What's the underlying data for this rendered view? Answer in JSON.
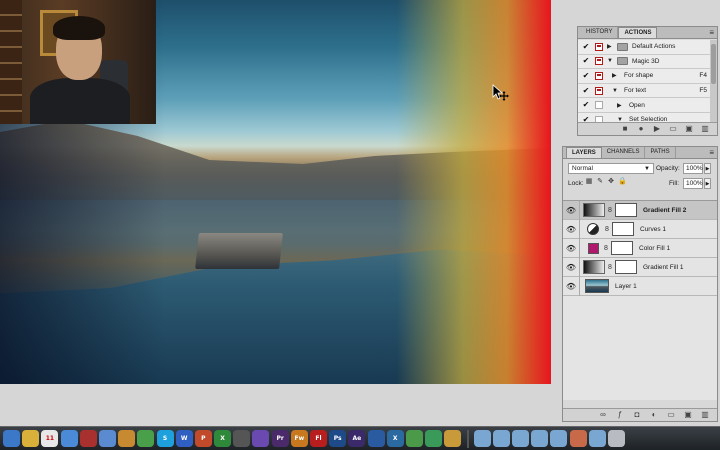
{
  "history_actions_panel": {
    "tabs": [
      "HISTORY",
      "ACTIONS"
    ],
    "active_tab": "ACTIONS",
    "rows": [
      {
        "checked": true,
        "dialog": true,
        "expand": "collapsed",
        "folder": true,
        "label": "Default Actions",
        "key": ""
      },
      {
        "checked": true,
        "dialog": true,
        "expand": "expanded",
        "folder": true,
        "label": "Magic 3D",
        "key": ""
      },
      {
        "checked": true,
        "dialog": true,
        "expand": "collapsed",
        "folder": false,
        "label": "For shape",
        "key": "F4"
      },
      {
        "checked": true,
        "dialog": true,
        "expand": "expanded",
        "folder": false,
        "label": "For text",
        "key": "F5"
      },
      {
        "checked": true,
        "dialog": false,
        "expand": "collapsed",
        "folder": false,
        "label": "Open",
        "key": ""
      },
      {
        "checked": true,
        "dialog": false,
        "expand": "expanded",
        "folder": false,
        "label": "Set Selection",
        "key": ""
      }
    ]
  },
  "layers_panel": {
    "tabs": [
      "LAYERS",
      "CHANNELS",
      "PATHS"
    ],
    "active_tab": "LAYERS",
    "blend_mode": "Normal",
    "opacity_label": "Opacity:",
    "opacity_value": "100%",
    "lock_label": "Lock:",
    "fill_label": "Fill:",
    "fill_value": "100%",
    "layers": [
      {
        "name": "Gradient Fill 2",
        "type": "gradient",
        "selected": true
      },
      {
        "name": "Curves 1",
        "type": "curves",
        "selected": false
      },
      {
        "name": "Color Fill 1",
        "type": "color",
        "selected": false
      },
      {
        "name": "Gradient Fill 1",
        "type": "gradient",
        "selected": false
      },
      {
        "name": "Layer 1",
        "type": "photo",
        "selected": false
      }
    ]
  },
  "dock": {
    "icons": [
      {
        "name": "finder",
        "label": "",
        "color": "#3c78c8"
      },
      {
        "name": "notes",
        "label": "",
        "color": "#d9b13a"
      },
      {
        "name": "calendar",
        "label": "11",
        "color": "#e8e8e8"
      },
      {
        "name": "itunes",
        "label": "",
        "color": "#4a8ad6"
      },
      {
        "name": "photo-booth",
        "label": "",
        "color": "#a8302e"
      },
      {
        "name": "iphoto",
        "label": "",
        "color": "#5a8ad0"
      },
      {
        "name": "paintbrush",
        "label": "",
        "color": "#c88a30"
      },
      {
        "name": "chrome",
        "label": "",
        "color": "#4aa04a"
      },
      {
        "name": "skype",
        "label": "S",
        "color": "#1ea0dc"
      },
      {
        "name": "word",
        "label": "W",
        "color": "#2f5fc0"
      },
      {
        "name": "powerpoint",
        "label": "P",
        "color": "#c04a2a"
      },
      {
        "name": "excel",
        "label": "X",
        "color": "#2e8a3a"
      },
      {
        "name": "clapper",
        "label": "",
        "color": "#555555"
      },
      {
        "name": "imovie",
        "label": "",
        "color": "#6a4ab0"
      },
      {
        "name": "premiere",
        "label": "Pr",
        "color": "#4a2a6a"
      },
      {
        "name": "fireworks",
        "label": "Fw",
        "color": "#c8781e"
      },
      {
        "name": "flash",
        "label": "Fl",
        "color": "#b81e1e"
      },
      {
        "name": "photoshop",
        "label": "Ps",
        "color": "#1e4a8a"
      },
      {
        "name": "after-effects",
        "label": "Ae",
        "color": "#3a2a6a"
      },
      {
        "name": "quicktime",
        "label": "",
        "color": "#2a5aa0"
      },
      {
        "name": "x11",
        "label": "X",
        "color": "#2a6aa0"
      },
      {
        "name": "evernote",
        "label": "",
        "color": "#4a9a4a"
      },
      {
        "name": "sketchup",
        "label": "",
        "color": "#3a9a5a"
      },
      {
        "name": "gamepad",
        "label": "",
        "color": "#c89a3a"
      }
    ],
    "right_icons": [
      {
        "name": "folder-apps",
        "color": "#7aa6d2"
      },
      {
        "name": "folder-docs",
        "color": "#7aa6d2"
      },
      {
        "name": "folder-downloads",
        "color": "#7aa6d2"
      },
      {
        "name": "folder-stack-1",
        "color": "#7aa6d2"
      },
      {
        "name": "folder-stack-2",
        "color": "#7aa6d2"
      },
      {
        "name": "photo-stack",
        "color": "#c86a4a"
      },
      {
        "name": "folder-stack-3",
        "color": "#7aa6d2"
      },
      {
        "name": "trash",
        "color": "#b8bcc2"
      }
    ]
  }
}
